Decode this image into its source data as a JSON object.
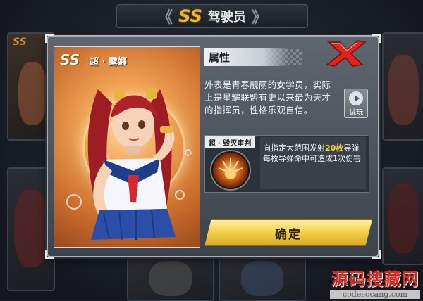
{
  "header": {
    "rank": "SS",
    "title": "驾驶员"
  },
  "background_cards": [
    {
      "rank": "SS"
    }
  ],
  "dialog": {
    "portrait": {
      "rank": "SS",
      "name": "超 · 露娜"
    },
    "attributes": {
      "heading": "属性",
      "description": "外表是青春靓丽的女学员，实际上是星耀联盟有史以来最为天才的指挥员，性格乐观自信。"
    },
    "trial_button": {
      "label": "试玩",
      "icon": "play-icon"
    },
    "close_button": {
      "icon": "close-x-icon"
    },
    "skill": {
      "name": "超 · 毁灭审判",
      "desc_prefix": "向指定大范围发射",
      "desc_highlight": "20枚",
      "desc_mid": "导弹",
      "desc_rest": "每枚导弹命中可造成1次伤害"
    },
    "confirm_button": {
      "label": "确定"
    }
  },
  "watermark": {
    "text": "源码搜藏网",
    "url": "codesocang.com"
  },
  "colors": {
    "accent_gold": "#f4d24e",
    "highlight_yellow": "#f7d63a",
    "close_red": "#e0231c",
    "rank_orange": "#f2b232"
  }
}
